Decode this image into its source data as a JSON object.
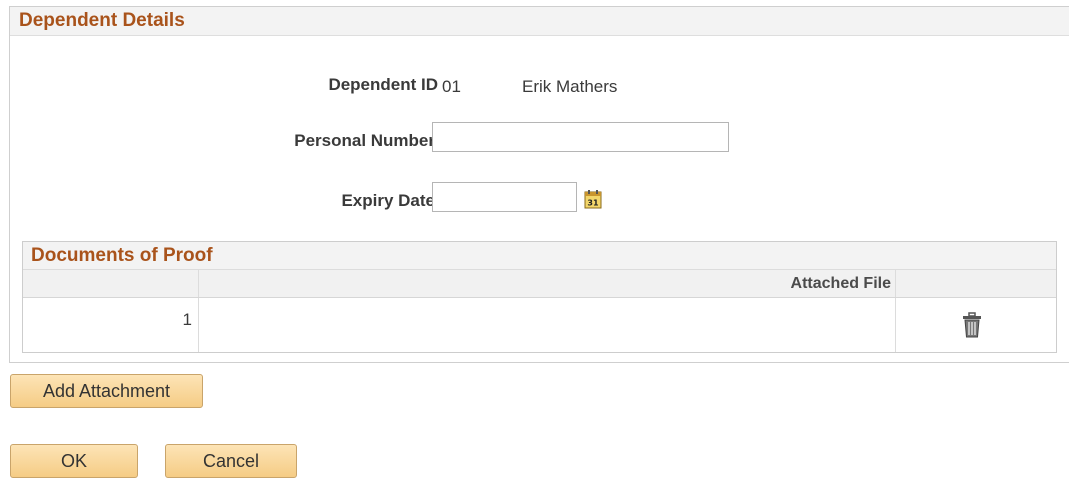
{
  "panel": {
    "title": "Dependent Details"
  },
  "dependent": {
    "id_label": "Dependent ID",
    "id_value": "01",
    "name": "Erik Mathers"
  },
  "personal_number": {
    "label": "Personal Number",
    "value": ""
  },
  "expiry_date": {
    "label": "Expiry Date",
    "value": ""
  },
  "documents": {
    "title": "Documents of Proof",
    "column_header": "Attached File",
    "rows": [
      {
        "num": "1",
        "file": ""
      }
    ]
  },
  "buttons": {
    "add_attachment": "Add Attachment",
    "ok": "OK",
    "cancel": "Cancel"
  },
  "icons": {
    "calendar": "calendar-icon",
    "delete": "trash-icon"
  }
}
